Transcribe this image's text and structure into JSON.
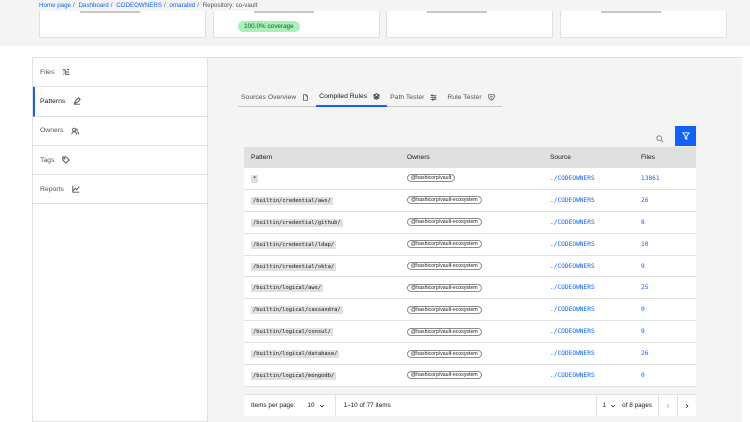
{
  "breadcrumb": [
    {
      "label": "Home page",
      "link": true
    },
    {
      "label": "Dashboard",
      "link": true
    },
    {
      "label": "CODEOWNERS",
      "link": true
    },
    {
      "label": "omarabid",
      "link": true
    },
    {
      "label": "Repository: co-vault",
      "link": false
    }
  ],
  "summary": {
    "coverage_badge": "100.0% coverage"
  },
  "sidebar": {
    "items": [
      {
        "label": "Files",
        "icon": "tree-view-icon"
      },
      {
        "label": "Patterns",
        "icon": "edit-icon"
      },
      {
        "label": "Owners",
        "icon": "user-multiple-icon"
      },
      {
        "label": "Tags",
        "icon": "tag-icon"
      },
      {
        "label": "Reports",
        "icon": "chart-line-icon"
      }
    ]
  },
  "tabs": [
    {
      "label": "Sources Overview",
      "icon": "document-icon"
    },
    {
      "label": "Compiled Rules",
      "icon": "layers-icon"
    },
    {
      "label": "Path Tester",
      "icon": "sliders-icon"
    },
    {
      "label": "Rule Tester",
      "icon": "shield-filter-icon"
    }
  ],
  "table": {
    "headers": {
      "pattern": "Pattern",
      "owners": "Owners",
      "source": "Source",
      "files": "Files"
    },
    "rows": [
      {
        "pattern": "*",
        "owner": "@hashicorp/vault",
        "source": "./CODEOWNERS",
        "files": "13861"
      },
      {
        "pattern": "/builtin/credential/aws/",
        "owner": "@hashicorp/vault-ecosystem",
        "source": "./CODEOWNERS",
        "files": "26"
      },
      {
        "pattern": "/builtin/credential/github/",
        "owner": "@hashicorp/vault-ecosystem",
        "source": "./CODEOWNERS",
        "files": "8"
      },
      {
        "pattern": "/builtin/credential/ldap/",
        "owner": "@hashicorp/vault-ecosystem",
        "source": "./CODEOWNERS",
        "files": "10"
      },
      {
        "pattern": "/builtin/credential/okta/",
        "owner": "@hashicorp/vault-ecosystem",
        "source": "./CODEOWNERS",
        "files": "9"
      },
      {
        "pattern": "/builtin/logical/aws/",
        "owner": "@hashicorp/vault-ecosystem",
        "source": "./CODEOWNERS",
        "files": "25"
      },
      {
        "pattern": "/builtin/logical/cassandra/",
        "owner": "@hashicorp/vault-ecosystem",
        "source": "./CODEOWNERS",
        "files": "0"
      },
      {
        "pattern": "/builtin/logical/consul/",
        "owner": "@hashicorp/vault-ecosystem",
        "source": "./CODEOWNERS",
        "files": "9"
      },
      {
        "pattern": "/builtin/logical/database/",
        "owner": "@hashicorp/vault-ecosystem",
        "source": "./CODEOWNERS",
        "files": "26"
      },
      {
        "pattern": "/builtin/logical/mongodb/",
        "owner": "@hashicorp/vault-ecosystem",
        "source": "./CODEOWNERS",
        "files": "0"
      }
    ]
  },
  "pagination": {
    "items_per_page_label": "Items per page:",
    "items_per_page": "10",
    "range": "1–10 of 77 items",
    "current_page": "1",
    "of_pages": "of 8 pages"
  },
  "colors": {
    "accent": "#0f62fe",
    "badge_bg": "#a7f0ba",
    "badge_text": "#0e6027"
  }
}
